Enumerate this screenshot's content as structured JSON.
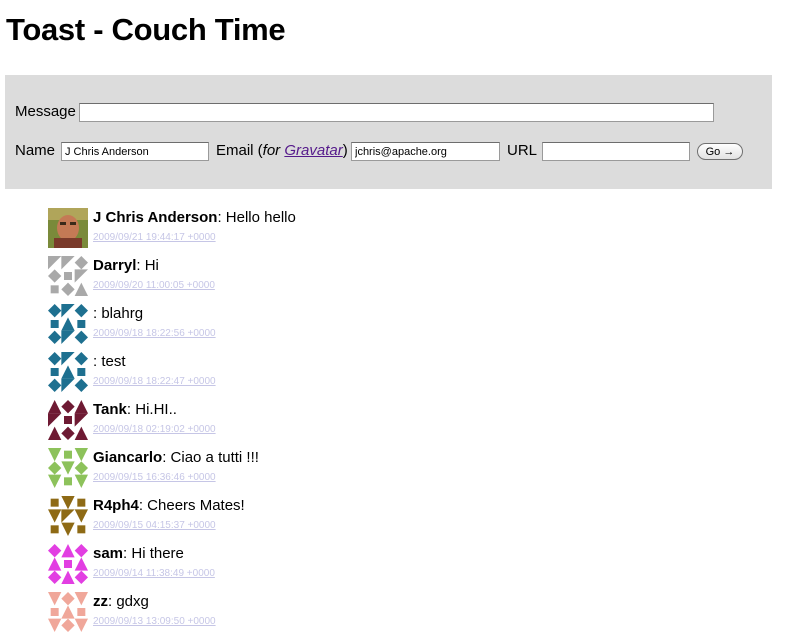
{
  "header": {
    "title": "Toast - Couch Time"
  },
  "form": {
    "message_label": "Message",
    "message_value": "",
    "name_label": "Name",
    "name_value": "J Chris Anderson",
    "email_label_prefix": "Email (",
    "email_label_for": "for ",
    "gravatar_link": "Gravatar",
    "email_label_suffix": ")",
    "email_value": "jchris@apache.org",
    "url_label": "URL",
    "url_value": "",
    "go_button": "Go →"
  },
  "messages": [
    {
      "author": "J Chris Anderson",
      "text": ": Hello hello",
      "time": "2009/09/21 19:44:17 +0000",
      "avatar": "photo-avatar"
    },
    {
      "author": "Darryl",
      "text": ": Hi",
      "time": "2009/09/20 11:00:05 +0000",
      "avatar": "identicon-gray"
    },
    {
      "author": "",
      "text": ": blahrg",
      "time": "2009/09/18 18:22:56 +0000",
      "avatar": "identicon-teal"
    },
    {
      "author": "",
      "text": ": test",
      "time": "2009/09/18 18:22:47 +0000",
      "avatar": "identicon-teal"
    },
    {
      "author": "Tank",
      "text": ": Hi.HI..",
      "time": "2009/09/18 02:19:02 +0000",
      "avatar": "identicon-maroon"
    },
    {
      "author": "Giancarlo",
      "text": ": Ciao a tutti !!!",
      "time": "2009/09/15 16:36:46 +0000",
      "avatar": "identicon-green"
    },
    {
      "author": "R4ph4",
      "text": ": Cheers Mates!",
      "time": "2009/09/15 04:15:37 +0000",
      "avatar": "identicon-brown"
    },
    {
      "author": "sam",
      "text": ": Hi there",
      "time": "2009/09/14 11:38:49 +0000",
      "avatar": "identicon-magenta"
    },
    {
      "author": "zz",
      "text": ": gdxg",
      "time": "2009/09/13 13:09:50 +0000",
      "avatar": "identicon-pink"
    }
  ],
  "colors": {
    "panel_bg": "#dcdcdc",
    "link": "#551a8b",
    "timestamp": "#c6c6e6",
    "avatar_gray": "#a9a9a9",
    "avatar_teal": "#1e7090",
    "avatar_maroon": "#6e1a33",
    "avatar_green": "#8dc25b",
    "avatar_brown": "#8e6a15",
    "avatar_magenta": "#e23ee2",
    "avatar_pink": "#f0a79a"
  }
}
